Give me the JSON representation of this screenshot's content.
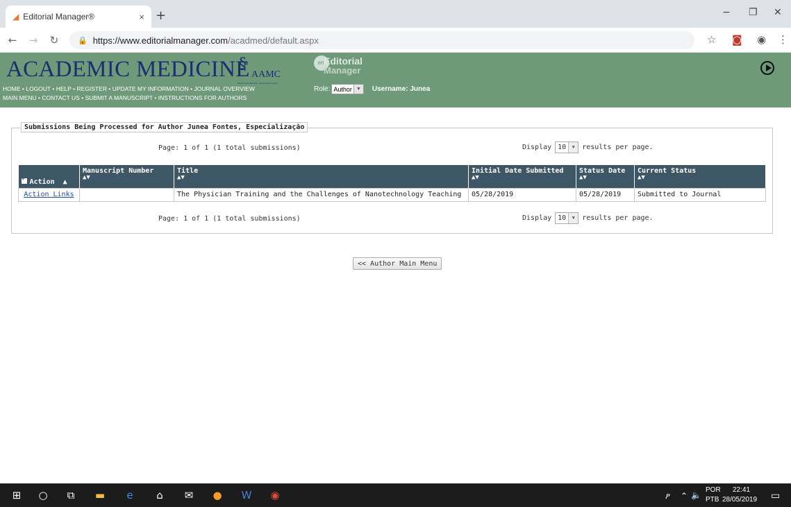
{
  "browser": {
    "tab_title": "Editorial Manager®",
    "tab_close": "×",
    "new_tab": "+",
    "url_main": "https://www.editorialmanager.com",
    "url_rest": "/acadmed/default.aspx",
    "window_minimize": "−",
    "window_restore": "❐",
    "window_close": "✕"
  },
  "header": {
    "journal_title": "ACADEMIC MEDICINE",
    "aamc_text": "AAMC",
    "aamc_tagline": "Tomorrow's Doctors, Tomorrow's Cures",
    "em_circle": "em",
    "em_line1": "Editorial",
    "em_line2": "Manager",
    "nav_row1": [
      "HOME",
      "LOGOUT",
      "HELP",
      "REGISTER",
      "UPDATE MY INFORMATION",
      "JOURNAL OVERVIEW"
    ],
    "nav_row2": [
      "MAIN MENU",
      "CONTACT US",
      "SUBMIT A MANUSCRIPT",
      "INSTRUCTIONS FOR AUTHORS"
    ],
    "separator": "•",
    "role_label": "Role:",
    "role_value": "Author",
    "username": "Username: Junea"
  },
  "panel": {
    "legend": "Submissions Being Processed for Author Junea Fontes, Especialização",
    "pager_text": "Page: 1 of 1 (1 total submissions)",
    "display_label": "Display",
    "display_value": "10",
    "results_label": "results per page."
  },
  "table": {
    "columns": [
      "Action",
      "Manuscript Number",
      "Title",
      "Initial Date Submitted",
      "Status Date",
      "Current Status"
    ],
    "sort_glyph": "▲▼",
    "rows": [
      {
        "action": "Action Links",
        "manuscript_number": "",
        "title": "The Physician Training and the Challenges of Nanotechnology Teaching",
        "initial_date": "05/28/2019",
        "status_date": "05/28/2019",
        "current_status": "Submitted to Journal"
      }
    ]
  },
  "main_menu_button": "<< Author Main Menu",
  "taskbar": {
    "lang_top": "POR",
    "lang_bottom": "PTB",
    "time": "22:41",
    "date": "28/05/2019"
  }
}
